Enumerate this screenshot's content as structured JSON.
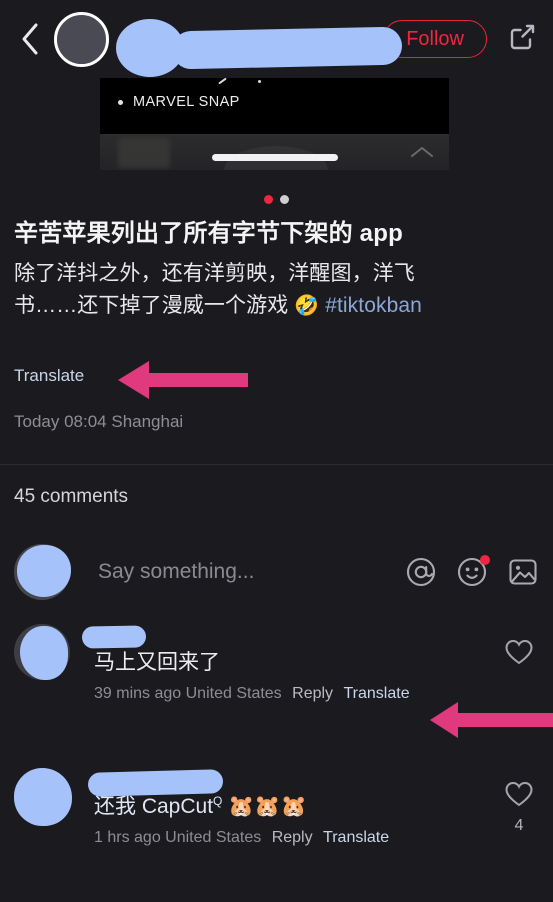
{
  "app": {
    "theme_background": "#1b1b1f",
    "accent_red": "#f0253f",
    "link_blue": "#c9d6ea",
    "redaction_color": "#a6c2fa",
    "annotation_pink": "#e0397e"
  },
  "topbar": {
    "back_icon": "chevron-left-icon",
    "author_name": "",
    "follow_label": "Follow",
    "share_icon": "share-external-icon"
  },
  "media": {
    "bullet_label": "MARVEL SNAP",
    "expand_icon": "chevron-up-icon"
  },
  "carousel": {
    "dots": [
      {
        "state": "active",
        "color": "#f0253f"
      },
      {
        "state": "idle",
        "color": "#cfcfcf"
      }
    ]
  },
  "post": {
    "title": "辛苦苹果列出了所有字节下架的 app",
    "body_line_1": "除了洋抖之外，还有洋剪映，洋醒图，洋飞",
    "body_line_2_prefix": "书……还下掉了漫威一个游戏 ",
    "body_emoji": "🤣",
    "hashtag": "#tiktokban",
    "translate_label": "Translate",
    "timestamp": "Today 08:04 Shanghai"
  },
  "comments_section": {
    "count_label": "45 comments",
    "composer": {
      "placeholder": "Say something...",
      "icons": [
        {
          "name": "mention-icon",
          "glyph": "@",
          "badge": false
        },
        {
          "name": "emoji-icon",
          "glyph": "smiley",
          "badge": true
        },
        {
          "name": "image-icon",
          "glyph": "picture",
          "badge": false
        }
      ]
    },
    "items": [
      {
        "username": "",
        "text": "马上又回来了",
        "text_suffix": "",
        "time": "39 mins ago",
        "location": "United States",
        "reply_label": "Reply",
        "translate_label": "Translate",
        "like_count": "",
        "like_icon": "heart-outline-icon"
      },
      {
        "username": "",
        "text": "还我 CapCut",
        "text_superscript": "Q",
        "text_suffix": " 🐹🐹🐹",
        "time": "1 hrs ago",
        "location": "United States",
        "reply_label": "Reply",
        "translate_label": "Translate",
        "like_count": "4",
        "like_icon": "heart-outline-icon"
      }
    ]
  },
  "annotations": [
    {
      "name": "arrow-pointing-to-post-translate",
      "direction": "left",
      "color": "#e0397e"
    },
    {
      "name": "arrow-pointing-to-comment-translate",
      "direction": "left",
      "color": "#e0397e"
    }
  ]
}
